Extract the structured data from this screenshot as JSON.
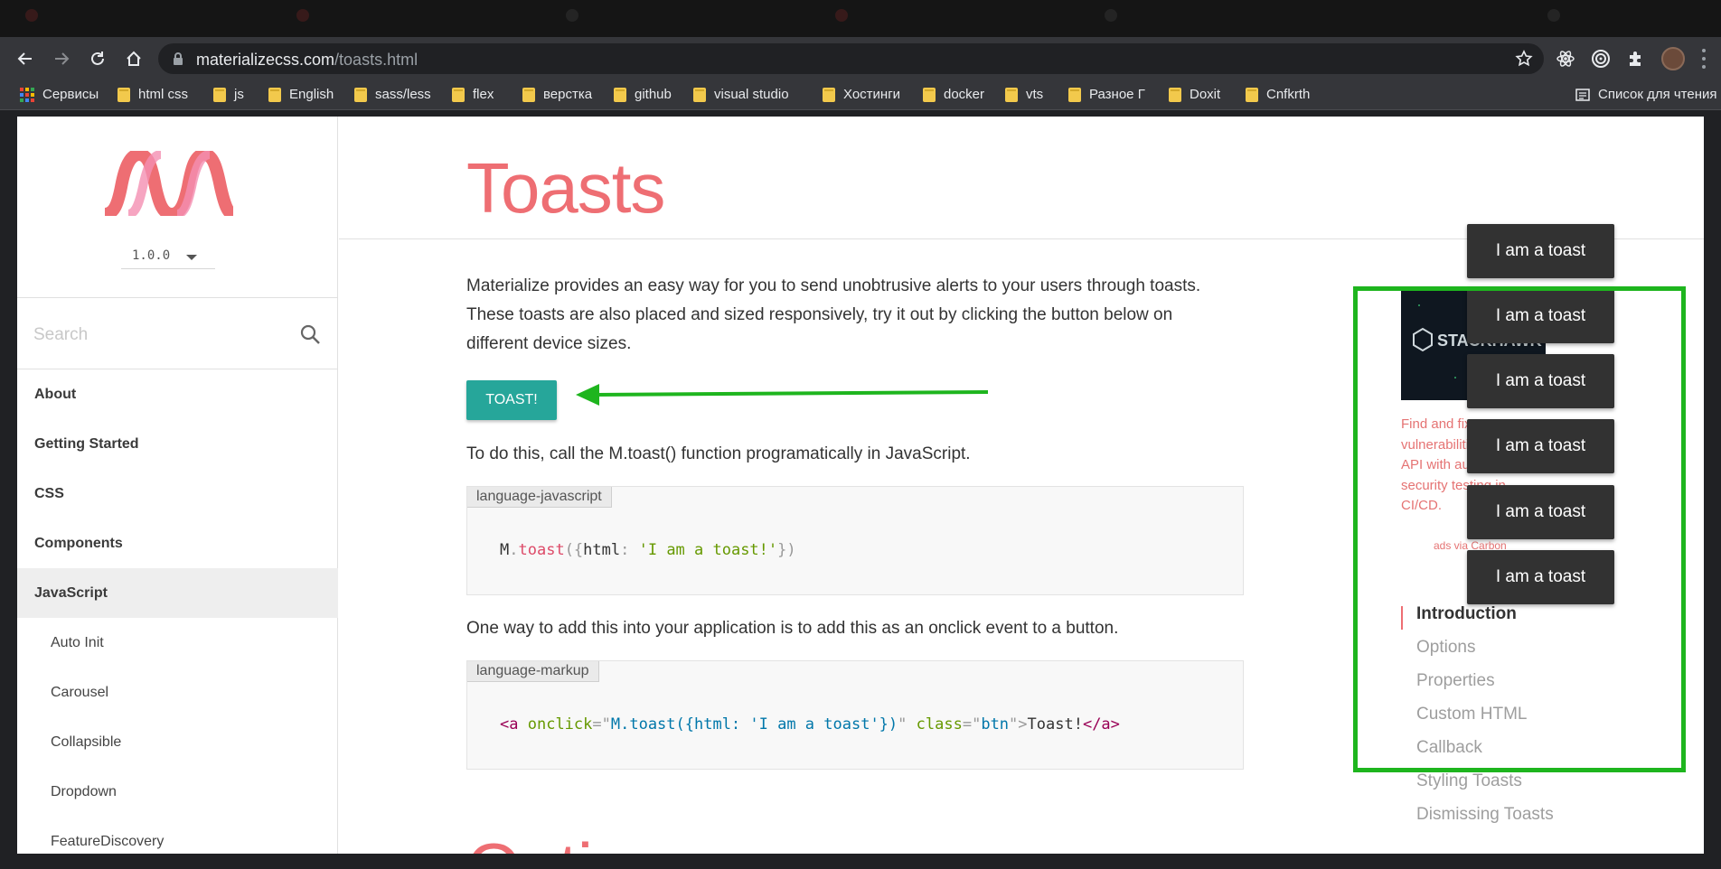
{
  "browser": {
    "url_host": "materializecss.com",
    "url_path": "/toasts.html",
    "bookmarks": [
      {
        "label": "Сервисы",
        "type": "apps"
      },
      {
        "label": "html css",
        "type": "folder"
      },
      {
        "label": "js",
        "type": "folder"
      },
      {
        "label": "English",
        "type": "folder"
      },
      {
        "label": "sass/less",
        "type": "folder"
      },
      {
        "label": "flex",
        "type": "folder"
      },
      {
        "label": "верстка",
        "type": "folder"
      },
      {
        "label": "github",
        "type": "folder"
      },
      {
        "label": "visual studio",
        "type": "folder"
      },
      {
        "label": "Хостинги",
        "type": "folder"
      },
      {
        "label": "docker",
        "type": "folder"
      },
      {
        "label": "vts",
        "type": "folder"
      },
      {
        "label": "Разное Г",
        "type": "folder"
      },
      {
        "label": "Doxit",
        "type": "folder"
      },
      {
        "label": "Cnfkrth",
        "type": "folder"
      }
    ],
    "reading_list": "Список для чтения"
  },
  "sidenav": {
    "version": "1.0.0",
    "search_placeholder": "Search",
    "items": [
      {
        "label": "About",
        "level": 0,
        "active": false
      },
      {
        "label": "Getting Started",
        "level": 0,
        "active": false
      },
      {
        "label": "CSS",
        "level": 0,
        "active": false
      },
      {
        "label": "Components",
        "level": 0,
        "active": false
      },
      {
        "label": "JavaScript",
        "level": 0,
        "active": true
      },
      {
        "label": "Auto Init",
        "level": 1,
        "active": false
      },
      {
        "label": "Carousel",
        "level": 1,
        "active": false
      },
      {
        "label": "Collapsible",
        "level": 1,
        "active": false
      },
      {
        "label": "Dropdown",
        "level": 1,
        "active": false
      },
      {
        "label": "FeatureDiscovery",
        "level": 1,
        "active": false
      }
    ]
  },
  "main": {
    "title": "Toasts",
    "intro": "Materialize provides an easy way for you to send unobtrusive alerts to your users through toasts.",
    "intro_2": "These toasts are also placed and sized responsively, try it out by clicking the button below on",
    "intro_3": "different device sizes.",
    "toast_button": "TOAST!",
    "call_text": "To do this, call the M.toast() function programatically in JavaScript.",
    "code1_lang": "language-javascript",
    "code1": {
      "obj": "M",
      "dot": ".",
      "fn": "toast",
      "open": "({",
      "key": "html",
      "colon": ": ",
      "str": "'I am a toast!'",
      "close": "})"
    },
    "onclick_text": "One way to add this into your application is to add this as an onclick event to a button.",
    "code2_lang": "language-markup",
    "code2": {
      "tag_open": "<a",
      "attr1": "onclick",
      "eq1": "=\"",
      "val1": "M.toast({html: 'I am a toast'})",
      "q1": "\"",
      "attr2": "class",
      "eq2": "=\"",
      "val2": "btn",
      "q2": "\">",
      "text": "Toast!",
      "tag_close": "</a>"
    },
    "next_heading": "Options"
  },
  "sidebar_right": {
    "ad_brand": "STACKHAWK",
    "ad_lines": [
      "Find and fix",
      "vulnerabilities",
      "API with automated",
      "security testing in",
      "CI/CD."
    ],
    "ad_via": "ads via Carbon",
    "toc": [
      "Introduction",
      "Options",
      "Properties",
      "Custom HTML",
      "Callback",
      "Styling Toasts",
      "Dismissing Toasts"
    ],
    "toc_active": "Introduction"
  },
  "toasts": [
    "I am a toast",
    "I am a toast",
    "I am a toast",
    "I am a toast",
    "I am a toast",
    "I am a toast"
  ],
  "colors": {
    "accent": "#ee6e73",
    "button": "#26a69a",
    "toast_bg": "#323232",
    "annotation": "#1eb51e"
  }
}
